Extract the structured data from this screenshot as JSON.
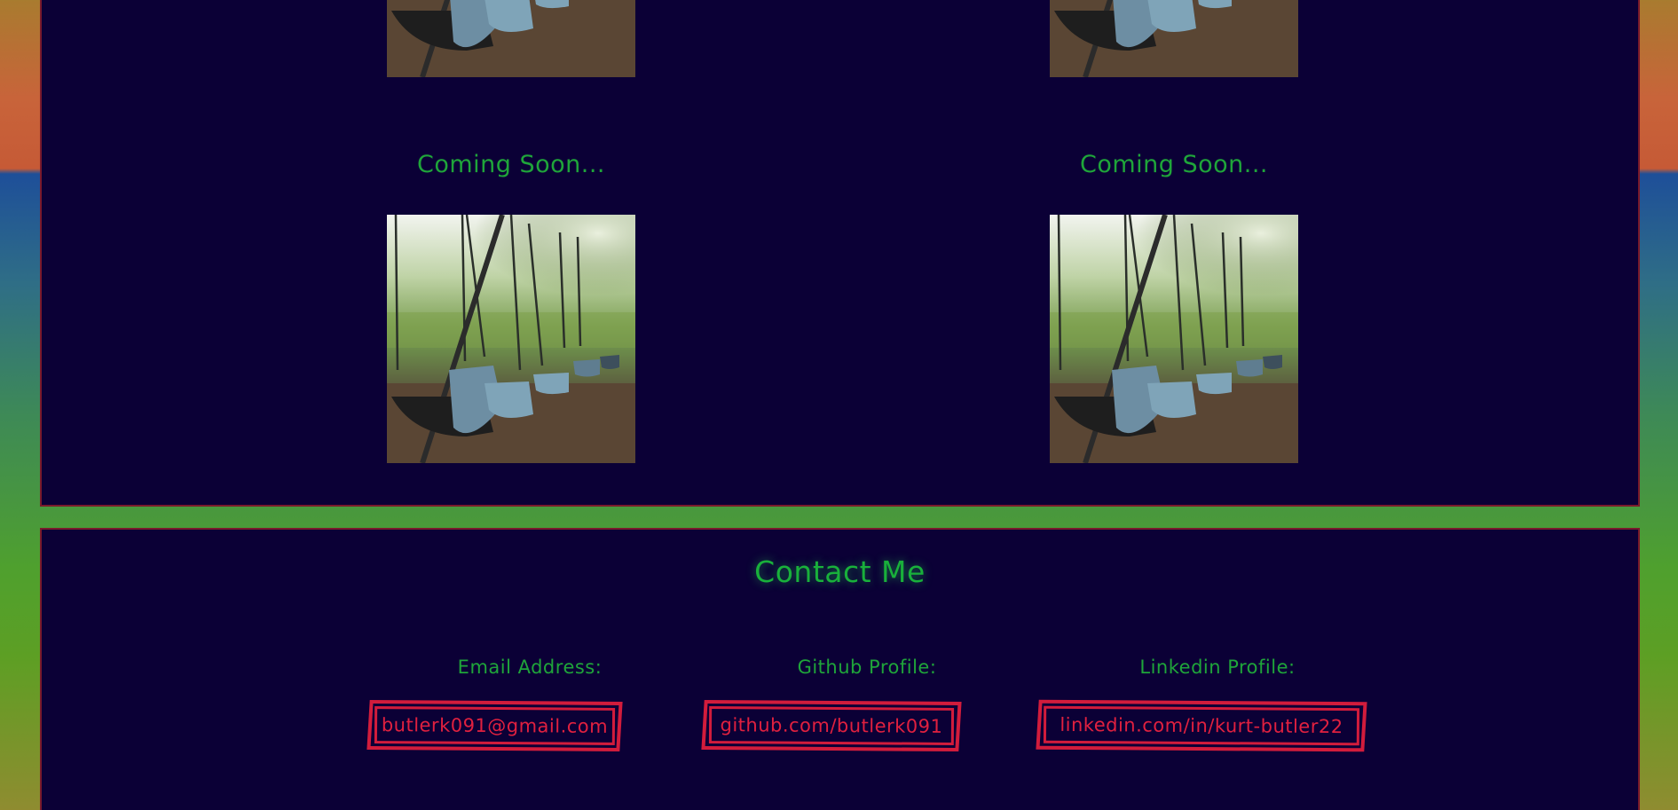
{
  "projects": [
    {
      "label": "Coming Soon..."
    },
    {
      "label": "Coming Soon..."
    }
  ],
  "contact": {
    "title": "Contact Me",
    "items": [
      {
        "label": "Email Address:",
        "value": "butlerk091@gmail.com"
      },
      {
        "label": "Github Profile:",
        "value": "github.com/butlerk091"
      },
      {
        "label": "Linkedin Profile:",
        "value": "linkedin.com/in/kurt-butler22"
      }
    ]
  },
  "colors": {
    "panel_bg": "#0b0036",
    "accent_green": "#1fa53a",
    "link_red": "#d21c3c",
    "panel_border": "#7a1a2c"
  },
  "icons": {
    "project_image": "swing-set-photo"
  }
}
